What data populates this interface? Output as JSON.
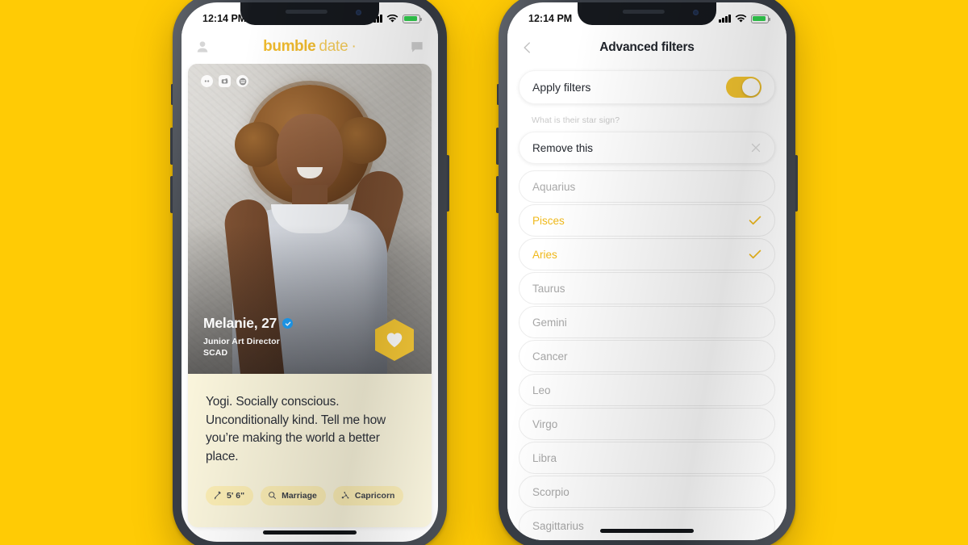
{
  "background_color": "#FFCB05",
  "accent_color": "#F5C630",
  "left_phone": {
    "status_bar": {
      "time": "12:14 PM",
      "signal_icon": "cellular-bars-icon",
      "wifi_icon": "wifi-icon",
      "battery_icon": "battery-icon"
    },
    "header": {
      "profile_icon": "person-icon",
      "logo_primary": "bumble",
      "logo_secondary": "date",
      "logo_dot": "·",
      "chat_icon": "chat-bubble-icon"
    },
    "photo_badges": [
      "bumble-badge-icon",
      "camera-icon",
      "music-icon"
    ],
    "profile": {
      "name_age": "Melanie, 27",
      "verified_icon": "verified-check-icon",
      "job_title": "Junior Art Director",
      "school": "SCAD",
      "like_button_icon": "heart-icon"
    },
    "bio": "Yogi. Socially conscious. Unconditionally kind. Tell me how you’re making the world a better place.",
    "chips": [
      {
        "icon": "height-ruler-icon",
        "label": "5' 6\""
      },
      {
        "icon": "search-intent-icon",
        "label": "Marriage"
      },
      {
        "icon": "star-sign-icon",
        "label": "Capricorn"
      }
    ]
  },
  "right_phone": {
    "status_bar": {
      "time": "12:14 PM",
      "signal_icon": "cellular-bars-icon",
      "wifi_icon": "wifi-icon",
      "battery_icon": "battery-icon"
    },
    "nav": {
      "back_icon": "chevron-left-icon",
      "title": "Advanced filters"
    },
    "apply_filters": {
      "label": "Apply filters",
      "enabled": true
    },
    "section_question": "What is their star sign?",
    "remove_row": {
      "label": "Remove this",
      "close_icon": "close-x-icon"
    },
    "star_signs": [
      {
        "label": "Aquarius",
        "selected": false
      },
      {
        "label": "Pisces",
        "selected": true
      },
      {
        "label": "Aries",
        "selected": true
      },
      {
        "label": "Taurus",
        "selected": false
      },
      {
        "label": "Gemini",
        "selected": false
      },
      {
        "label": "Cancer",
        "selected": false
      },
      {
        "label": "Leo",
        "selected": false
      },
      {
        "label": "Virgo",
        "selected": false
      },
      {
        "label": "Libra",
        "selected": false
      },
      {
        "label": "Scorpio",
        "selected": false
      },
      {
        "label": "Sagittarius",
        "selected": false
      }
    ]
  }
}
